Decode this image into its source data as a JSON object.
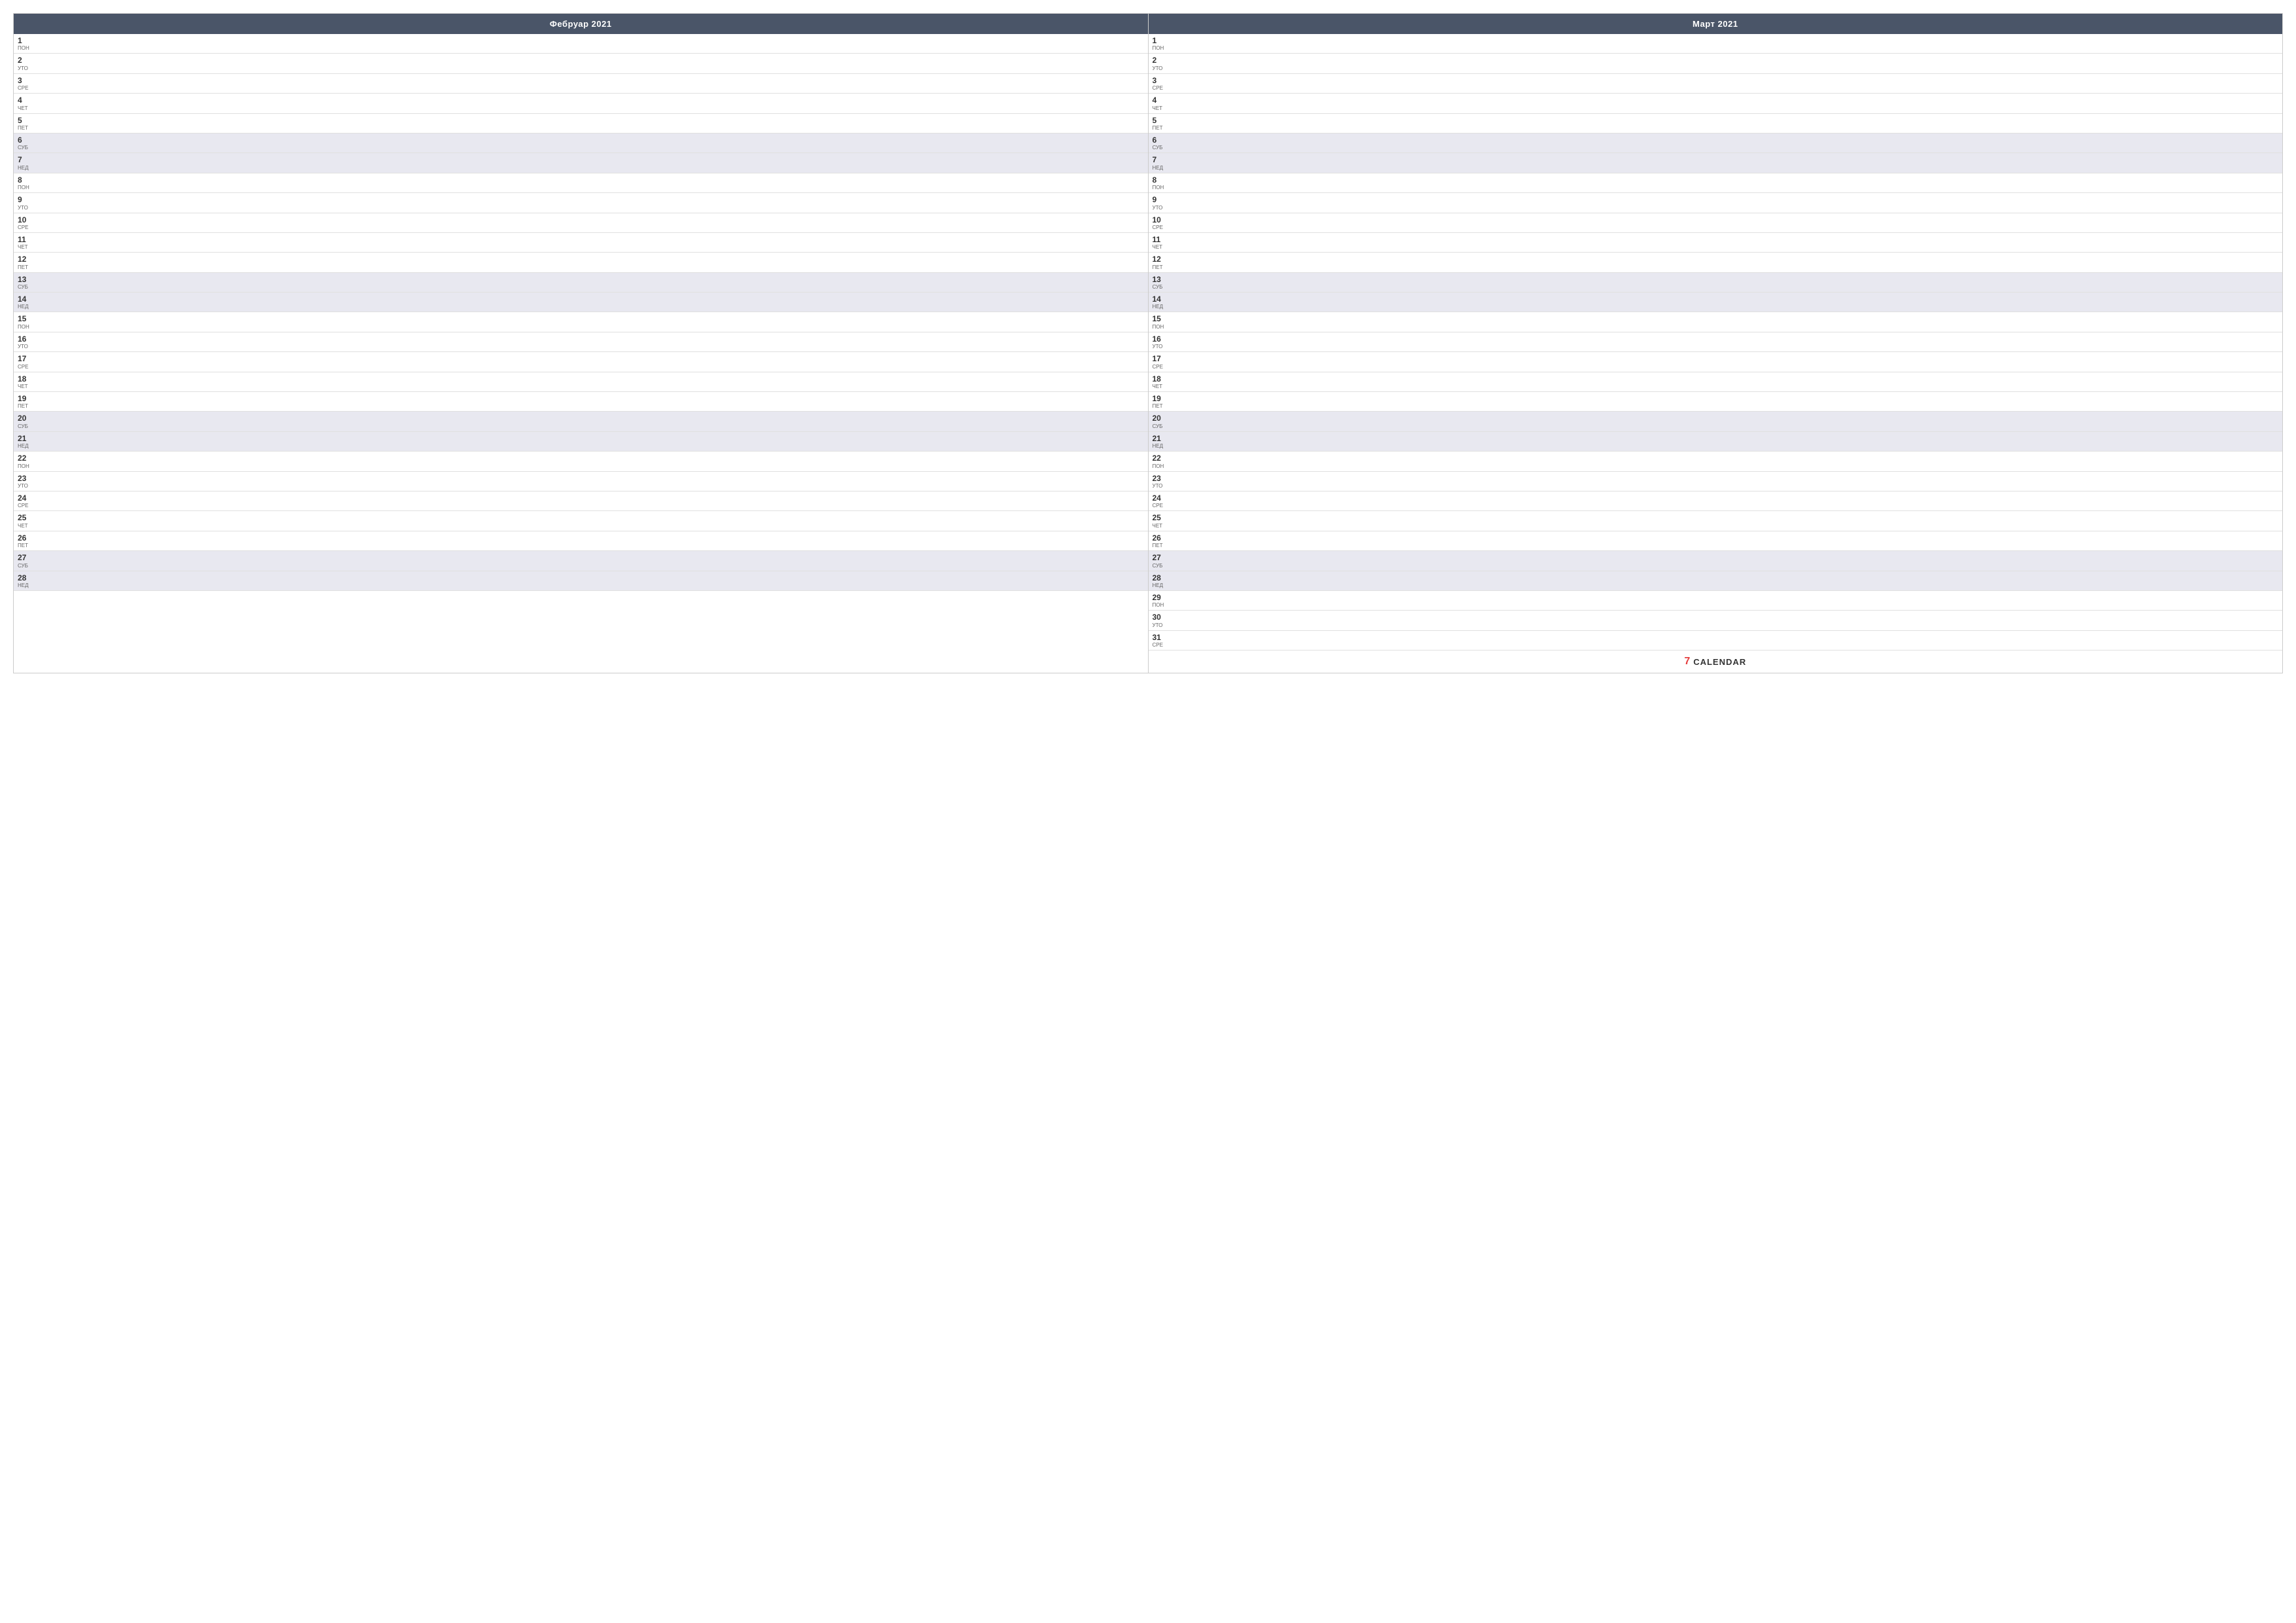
{
  "february": {
    "title": "Фебруар 2021",
    "days": [
      {
        "num": "1",
        "name": "ПОН",
        "weekend": false
      },
      {
        "num": "2",
        "name": "УТО",
        "weekend": false
      },
      {
        "num": "3",
        "name": "СРЕ",
        "weekend": false
      },
      {
        "num": "4",
        "name": "ЧЕТ",
        "weekend": false
      },
      {
        "num": "5",
        "name": "ПЕТ",
        "weekend": false
      },
      {
        "num": "6",
        "name": "СУБ",
        "weekend": true
      },
      {
        "num": "7",
        "name": "НЕД",
        "weekend": true
      },
      {
        "num": "8",
        "name": "ПОН",
        "weekend": false
      },
      {
        "num": "9",
        "name": "УТО",
        "weekend": false
      },
      {
        "num": "10",
        "name": "СРЕ",
        "weekend": false
      },
      {
        "num": "11",
        "name": "ЧЕТ",
        "weekend": false
      },
      {
        "num": "12",
        "name": "ПЕТ",
        "weekend": false
      },
      {
        "num": "13",
        "name": "СУБ",
        "weekend": true
      },
      {
        "num": "14",
        "name": "НЕД",
        "weekend": true
      },
      {
        "num": "15",
        "name": "ПОН",
        "weekend": false
      },
      {
        "num": "16",
        "name": "УТО",
        "weekend": false
      },
      {
        "num": "17",
        "name": "СРЕ",
        "weekend": false
      },
      {
        "num": "18",
        "name": "ЧЕТ",
        "weekend": false
      },
      {
        "num": "19",
        "name": "ПЕТ",
        "weekend": false
      },
      {
        "num": "20",
        "name": "СУБ",
        "weekend": true
      },
      {
        "num": "21",
        "name": "НЕД",
        "weekend": true
      },
      {
        "num": "22",
        "name": "ПОН",
        "weekend": false
      },
      {
        "num": "23",
        "name": "УТО",
        "weekend": false
      },
      {
        "num": "24",
        "name": "СРЕ",
        "weekend": false
      },
      {
        "num": "25",
        "name": "ЧЕТ",
        "weekend": false
      },
      {
        "num": "26",
        "name": "ПЕТ",
        "weekend": false
      },
      {
        "num": "27",
        "name": "СУБ",
        "weekend": true
      },
      {
        "num": "28",
        "name": "НЕД",
        "weekend": true
      }
    ]
  },
  "march": {
    "title": "Март 2021",
    "days": [
      {
        "num": "1",
        "name": "ПОН",
        "weekend": false
      },
      {
        "num": "2",
        "name": "УТО",
        "weekend": false
      },
      {
        "num": "3",
        "name": "СРЕ",
        "weekend": false
      },
      {
        "num": "4",
        "name": "ЧЕТ",
        "weekend": false
      },
      {
        "num": "5",
        "name": "ПЕТ",
        "weekend": false
      },
      {
        "num": "6",
        "name": "СУБ",
        "weekend": true
      },
      {
        "num": "7",
        "name": "НЕД",
        "weekend": true
      },
      {
        "num": "8",
        "name": "ПОН",
        "weekend": false
      },
      {
        "num": "9",
        "name": "УТО",
        "weekend": false
      },
      {
        "num": "10",
        "name": "СРЕ",
        "weekend": false
      },
      {
        "num": "11",
        "name": "ЧЕТ",
        "weekend": false
      },
      {
        "num": "12",
        "name": "ПЕТ",
        "weekend": false
      },
      {
        "num": "13",
        "name": "СУБ",
        "weekend": true
      },
      {
        "num": "14",
        "name": "НЕД",
        "weekend": true
      },
      {
        "num": "15",
        "name": "ПОН",
        "weekend": false
      },
      {
        "num": "16",
        "name": "УТО",
        "weekend": false
      },
      {
        "num": "17",
        "name": "СРЕ",
        "weekend": false
      },
      {
        "num": "18",
        "name": "ЧЕТ",
        "weekend": false
      },
      {
        "num": "19",
        "name": "ПЕТ",
        "weekend": false
      },
      {
        "num": "20",
        "name": "СУБ",
        "weekend": true
      },
      {
        "num": "21",
        "name": "НЕД",
        "weekend": true
      },
      {
        "num": "22",
        "name": "ПОН",
        "weekend": false
      },
      {
        "num": "23",
        "name": "УТО",
        "weekend": false
      },
      {
        "num": "24",
        "name": "СРЕ",
        "weekend": false
      },
      {
        "num": "25",
        "name": "ЧЕТ",
        "weekend": false
      },
      {
        "num": "26",
        "name": "ПЕТ",
        "weekend": false
      },
      {
        "num": "27",
        "name": "СУБ",
        "weekend": true
      },
      {
        "num": "28",
        "name": "НЕД",
        "weekend": true
      },
      {
        "num": "29",
        "name": "ПОН",
        "weekend": false
      },
      {
        "num": "30",
        "name": "УТО",
        "weekend": false
      },
      {
        "num": "31",
        "name": "СРЕ",
        "weekend": false
      }
    ]
  },
  "footer": {
    "icon": "7",
    "label": "CALENDAR"
  }
}
